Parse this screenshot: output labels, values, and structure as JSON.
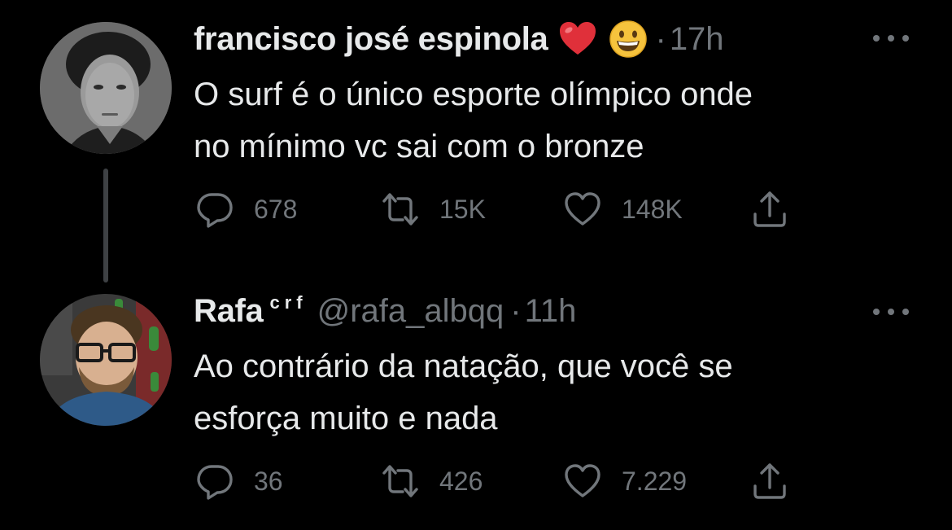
{
  "tweets": [
    {
      "display_name": "francisco josé espinola",
      "name_emojis": [
        "red-heart",
        "grinning-face"
      ],
      "separator": "·",
      "time": "17h",
      "text_lines": [
        "O surf é o único esporte olímpico onde",
        "no mínimo vc sai com o bronze"
      ],
      "reply_count": "678",
      "retweet_count": "15K",
      "like_count": "148K"
    },
    {
      "display_name": "Rafa",
      "name_suffix": "crf",
      "handle": "@rafa_albqq",
      "separator": "·",
      "time": "11h",
      "text_lines": [
        "Ao contrário da natação, que você se",
        "esforça muito e nada"
      ],
      "reply_count": "36",
      "retweet_count": "426",
      "like_count": "7.229"
    }
  ],
  "colors": {
    "background": "#000000",
    "primary_text": "#e7e9ea",
    "secondary_text": "#71767b",
    "thread_line": "#3e4144"
  }
}
